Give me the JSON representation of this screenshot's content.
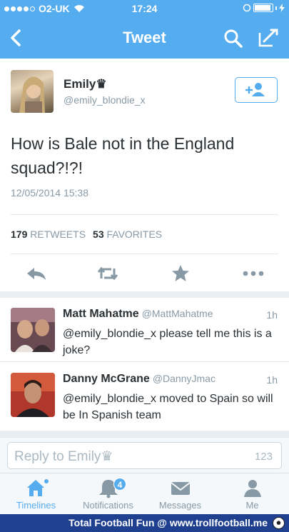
{
  "status_bar": {
    "carrier": "O2-UK",
    "time": "17:24",
    "battery_percent": 90
  },
  "nav": {
    "title": "Tweet",
    "icons": [
      "chevron-left-icon",
      "search-icon",
      "compose-icon"
    ]
  },
  "tweet": {
    "author_name": "Emily♛",
    "author_handle": "@emily_blondie_x",
    "text": "How is Bale not in the England squad?!?!",
    "timestamp": "12/05/2014 15:38",
    "retweet_count": "179",
    "retweet_label": "RETWEETS",
    "favorite_count": "53",
    "favorite_label": "FAVORITES",
    "follow_icon": "add-user-icon",
    "action_icons": [
      "reply-icon",
      "retweet-icon",
      "favorite-star-icon",
      "more-icon"
    ]
  },
  "replies": [
    {
      "name": "Matt Mahatme",
      "handle": "@MattMahatme",
      "time": "1h",
      "text": "@emily_blondie_x please tell me this is a joke?"
    },
    {
      "name": "Danny McGrane",
      "handle": "@DannyJmac",
      "time": "1h",
      "text": "@emily_blondie_x moved to Spain so will be In Spanish team"
    }
  ],
  "reply_box": {
    "placeholder": "Reply to Emily♛",
    "char_count": "123"
  },
  "tab_bar": {
    "tabs": [
      {
        "label": "Timelines",
        "icon": "home-icon",
        "active": true
      },
      {
        "label": "Notifications",
        "icon": "bell-icon",
        "badge": "4"
      },
      {
        "label": "Messages",
        "icon": "envelope-icon"
      },
      {
        "label": "Me",
        "icon": "person-icon"
      }
    ]
  },
  "watermark": {
    "text": "Total Football Fun @ www.trollfootball.me",
    "icon": "soccer-ball-icon"
  },
  "colors": {
    "accent": "#55acee",
    "text": "#292f33",
    "muted": "#8899a6",
    "watermark_bg": "#1f3f8f"
  }
}
